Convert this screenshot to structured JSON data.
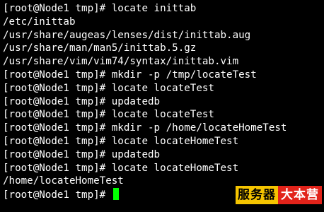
{
  "terminal": {
    "lines": [
      "[root@Node1 tmp]# locate inittab",
      "/etc/inittab",
      "/usr/share/augeas/lenses/dist/inittab.aug",
      "/usr/share/man/man5/inittab.5.gz",
      "/usr/share/vim/vim74/syntax/inittab.vim",
      "[root@Node1 tmp]# mkdir -p /tmp/locateTest",
      "[root@Node1 tmp]# locate locateTest",
      "[root@Node1 tmp]# updatedb",
      "[root@Node1 tmp]# locate locateTest",
      "[root@Node1 tmp]# mkdir -p /home/locateHomeTest",
      "[root@Node1 tmp]# locate locateHomeTest",
      "[root@Node1 tmp]# updatedb",
      "[root@Node1 tmp]# locate locateHomeTest",
      "/home/locateHomeTest"
    ],
    "prompt": "[root@Node1 tmp]# ",
    "cursor_color": "#00ff00"
  },
  "watermark": {
    "left_text": "服务器",
    "right_text": "大本营",
    "left_color": "#f5c400",
    "right_color": "#e2231a"
  }
}
